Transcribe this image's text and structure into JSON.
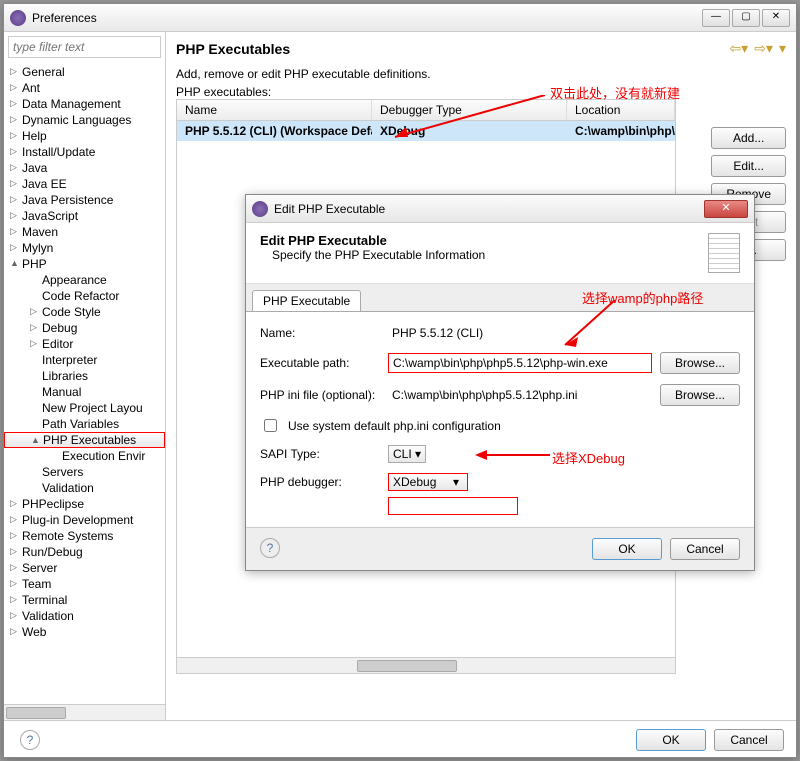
{
  "window": {
    "title": "Preferences"
  },
  "filter_placeholder": "type filter text",
  "tree": [
    {
      "l": 1,
      "a": "▷",
      "t": "General"
    },
    {
      "l": 1,
      "a": "▷",
      "t": "Ant"
    },
    {
      "l": 1,
      "a": "▷",
      "t": "Data Management"
    },
    {
      "l": 1,
      "a": "▷",
      "t": "Dynamic Languages"
    },
    {
      "l": 1,
      "a": "▷",
      "t": "Help"
    },
    {
      "l": 1,
      "a": "▷",
      "t": "Install/Update"
    },
    {
      "l": 1,
      "a": "▷",
      "t": "Java"
    },
    {
      "l": 1,
      "a": "▷",
      "t": "Java EE"
    },
    {
      "l": 1,
      "a": "▷",
      "t": "Java Persistence"
    },
    {
      "l": 1,
      "a": "▷",
      "t": "JavaScript"
    },
    {
      "l": 1,
      "a": "▷",
      "t": "Maven"
    },
    {
      "l": 1,
      "a": "▷",
      "t": "Mylyn"
    },
    {
      "l": 1,
      "a": "▲",
      "t": "PHP"
    },
    {
      "l": 2,
      "t": "Appearance"
    },
    {
      "l": 2,
      "t": "Code Refactor"
    },
    {
      "l": 2,
      "a": "▷",
      "t": "Code Style"
    },
    {
      "l": 2,
      "a": "▷",
      "t": "Debug"
    },
    {
      "l": 2,
      "a": "▷",
      "t": "Editor"
    },
    {
      "l": 2,
      "t": "Interpreter"
    },
    {
      "l": 2,
      "t": "Libraries"
    },
    {
      "l": 2,
      "t": "Manual"
    },
    {
      "l": 2,
      "t": "New Project Layou"
    },
    {
      "l": 2,
      "t": "Path Variables"
    },
    {
      "l": 2,
      "a": "▲",
      "t": "PHP Executables",
      "sel": true
    },
    {
      "l": 3,
      "t": "Execution Envir"
    },
    {
      "l": 2,
      "t": "Servers"
    },
    {
      "l": 2,
      "t": "Validation"
    },
    {
      "l": 1,
      "a": "▷",
      "t": "PHPeclipse"
    },
    {
      "l": 1,
      "a": "▷",
      "t": "Plug-in Development"
    },
    {
      "l": 1,
      "a": "▷",
      "t": "Remote Systems"
    },
    {
      "l": 1,
      "a": "▷",
      "t": "Run/Debug"
    },
    {
      "l": 1,
      "a": "▷",
      "t": "Server"
    },
    {
      "l": 1,
      "a": "▷",
      "t": "Team"
    },
    {
      "l": 1,
      "a": "▷",
      "t": "Terminal"
    },
    {
      "l": 1,
      "a": "▷",
      "t": "Validation"
    },
    {
      "l": 1,
      "a": "▷",
      "t": "Web"
    }
  ],
  "page": {
    "title": "PHP Executables",
    "desc": "Add, remove or edit PHP executable definitions.",
    "list_label": "PHP executables:",
    "cols": {
      "name": "Name",
      "dbg": "Debugger Type",
      "loc": "Location"
    },
    "row": {
      "name": "PHP 5.5.12 (CLI)  (Workspace Defa...",
      "dbg": "XDebug",
      "loc": "C:\\wamp\\bin\\php\\p"
    },
    "btns": {
      "add": "Add...",
      "edit": "Edit...",
      "remove": "Remove",
      "default": "ault",
      "search": "h..."
    }
  },
  "footer": {
    "ok": "OK",
    "cancel": "Cancel"
  },
  "modal": {
    "title": "Edit PHP Executable",
    "header": "Edit PHP Executable",
    "sub": "Specify the PHP Executable Information",
    "tab": "PHP Executable",
    "name_lbl": "Name:",
    "name_val": "PHP 5.5.12 (CLI)",
    "exe_lbl": "Executable path:",
    "exe_val": "C:\\wamp\\bin\\php\\php5.5.12\\php-win.exe",
    "ini_lbl": "PHP ini file (optional):",
    "ini_val": "C:\\wamp\\bin\\php\\php5.5.12\\php.ini",
    "chk_lbl": "Use system default php.ini configuration",
    "sapi_lbl": "SAPI Type:",
    "sapi_val": "CLI",
    "dbg_lbl": "PHP debugger:",
    "dbg_val": "XDebug",
    "browse": "Browse...",
    "ok": "OK",
    "cancel": "Cancel"
  },
  "anno": {
    "a1": "双击此处，没有就新建",
    "a2": "选择wamp的php路径",
    "a3": "选择XDebug"
  }
}
